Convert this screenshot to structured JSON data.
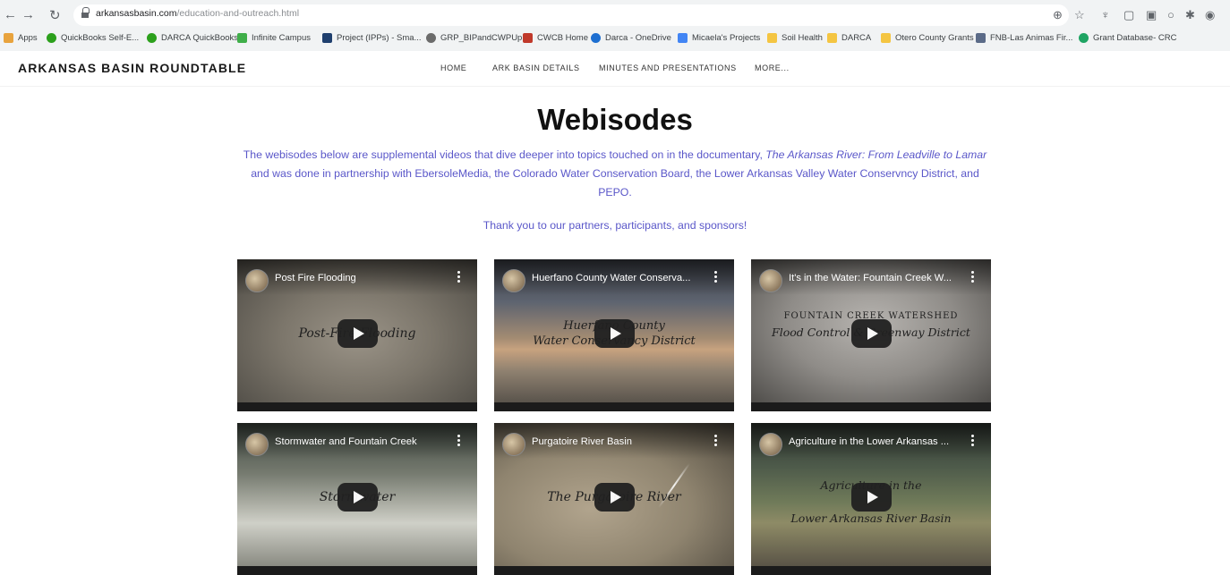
{
  "browser": {
    "url_domain": "arkansasbasin.com",
    "url_path": "/education-and-outreach.html",
    "bookmarks": [
      {
        "label": "Apps",
        "color": "#e8a33d"
      },
      {
        "label": "QuickBooks Self-E...",
        "color": "#2ca01c"
      },
      {
        "label": "DARCA QuickBooks",
        "color": "#2ca01c"
      },
      {
        "label": "Infinite Campus",
        "color": "#3fae49"
      },
      {
        "label": "Project (IPPs) - Sma...",
        "color": "#1f3f6e"
      },
      {
        "label": "GRP_BIPandCWPUp...",
        "color": "#6b6b6b"
      },
      {
        "label": "CWCB Home",
        "color": "#c0392b"
      },
      {
        "label": "Darca - OneDrive",
        "color": "#1d6fd1"
      },
      {
        "label": "Micaela's Projects",
        "color": "#4285f4"
      },
      {
        "label": "Soil Health",
        "color": "#f4c542"
      },
      {
        "label": "DARCA",
        "color": "#f4c542"
      },
      {
        "label": "Otero County Grants",
        "color": "#f4c542"
      },
      {
        "label": "FNB-Las Animas Fir...",
        "color": "#5b6b88"
      },
      {
        "label": "Grant Database- CRC",
        "color": "#1fa463"
      }
    ]
  },
  "site": {
    "title": "ARKANSAS BASIN ROUNDTABLE",
    "nav": [
      "HOME",
      "ARK BASIN DETAILS",
      "MINUTES AND PRESENTATIONS",
      "MORE..."
    ]
  },
  "page": {
    "heading": "Webisodes",
    "intro_before": "The webisodes below are supplemental videos that dive deeper into topics touched on in the documentary, ",
    "intro_title": "The Arkansas River: From Leadville to Lamar",
    "intro_after": " and was done in partnership with EbersoleMedia, the Colorado Water Conservation Board, the Lower Arkansas Valley Water Conservncy District, and PEPO.",
    "thanks": "Thank you to our partners, participants, and sponsors!"
  },
  "videos": [
    {
      "title": "Post Fire Flooding",
      "caption": "Post-Fire Flooding"
    },
    {
      "title": "Huerfano County Water Conserva...",
      "caption_top": "Huerfano County",
      "caption": "Water Conservancy District"
    },
    {
      "title": "It's in the Water: Fountain Creek W...",
      "caption_top": "FOUNTAIN CREEK WATERSHED",
      "caption": "Flood Control & Greenway District"
    },
    {
      "title": "Stormwater and Fountain Creek",
      "caption": "Stormwater"
    },
    {
      "title": "Purgatoire River Basin",
      "caption": "The Purgatoire River"
    },
    {
      "title": "Agriculture in the Lower Arkansas ...",
      "caption_top": "Agriculture in the",
      "caption": "Lower Arkansas River Basin"
    }
  ]
}
